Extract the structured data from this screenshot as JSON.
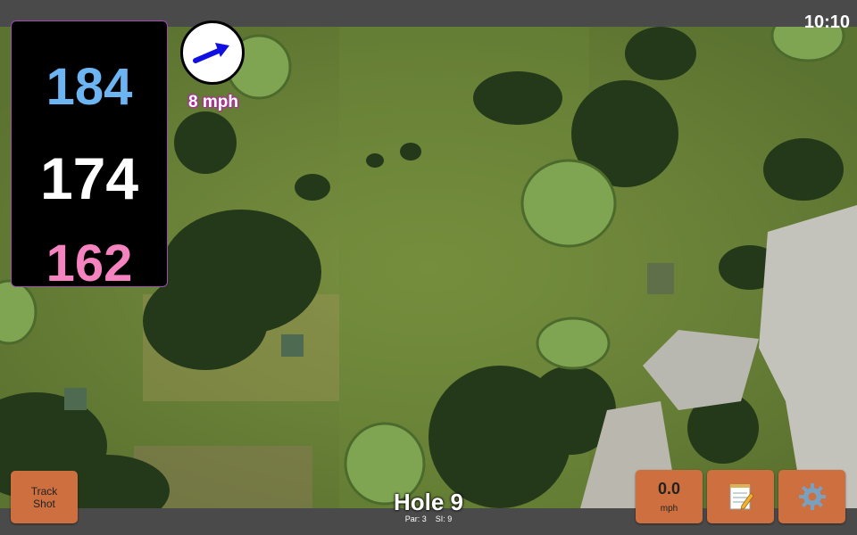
{
  "status": {
    "time": "10:10"
  },
  "distances": {
    "back": "184",
    "center": "174",
    "front": "162"
  },
  "wind": {
    "speed_label": "8 mph",
    "direction_icon": "wind-arrow-icon"
  },
  "hole": {
    "title": "Hole 9",
    "par_label": "Par: 3",
    "si_label": "SI: 9"
  },
  "buttons": {
    "track_shot_line1": "Track",
    "track_shot_line2": "Shot",
    "speed_value": "0.0",
    "speed_unit": "mph",
    "notes_icon": "notepad-icon",
    "settings_icon": "gear-icon"
  },
  "colors": {
    "back_distance": "#6cb4f2",
    "center_distance": "#ffffff",
    "front_distance": "#f583c0",
    "button": "#cd6f3e",
    "wind_arrow": "#1010e0"
  }
}
